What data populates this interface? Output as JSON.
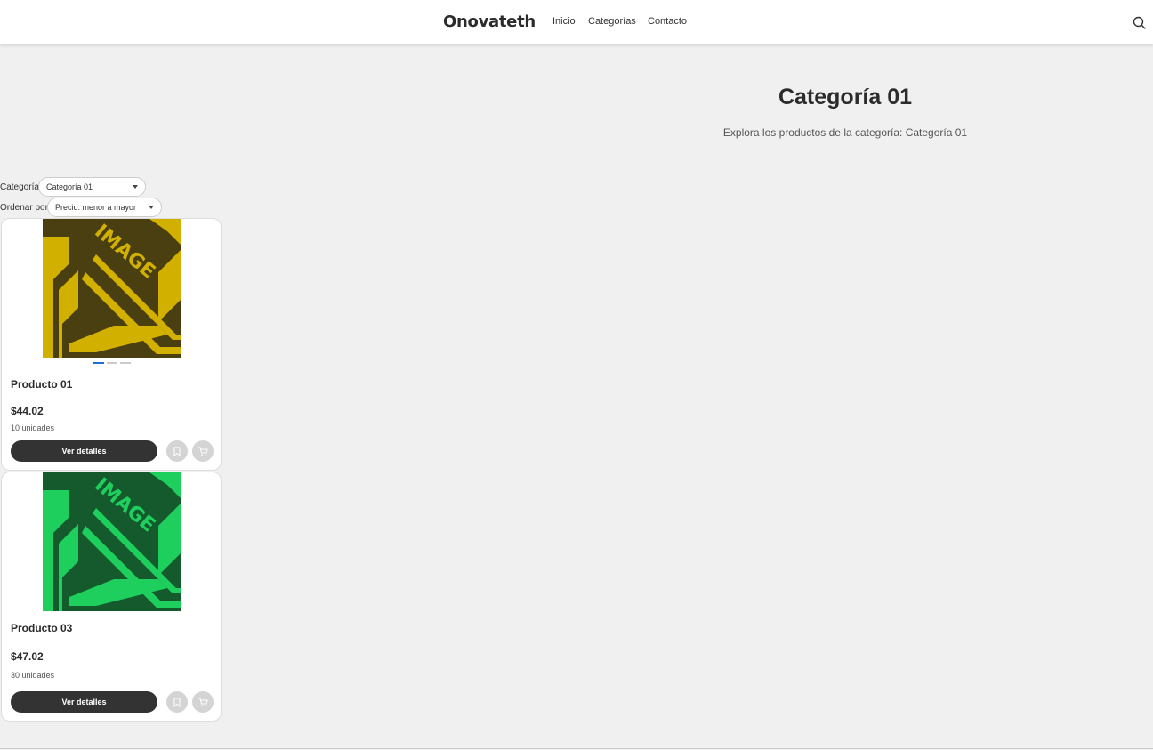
{
  "header": {
    "brand": "Onovateth",
    "nav": [
      "Inicio",
      "Categorías",
      "Contacto"
    ],
    "search_icon": "search-icon"
  },
  "hero": {
    "title": "Categoría 01",
    "subtitle": "Explora los productos de la categoría: Categoría 01"
  },
  "filters": {
    "category_label": "Categoría",
    "category_value": "Categoría 01",
    "order_label": "Ordenar por",
    "order_value": "Precio: menor a mayor"
  },
  "products": [
    {
      "name": "Producto 01",
      "price": "$44.02",
      "units": "10 unidades",
      "details_label": "Ver detalles",
      "image_text": "IMAGE",
      "image_colors": {
        "bg": "#4a3f10",
        "fg": "#d1b000"
      }
    },
    {
      "name": "Producto 03",
      "price": "$47.02",
      "units": "30 unidades",
      "details_label": "Ver detalles",
      "image_text": "IMAGE",
      "image_colors": {
        "bg": "#145a2c",
        "fg": "#1ecf5e"
      }
    }
  ],
  "colors": {
    "accent": "#1e6fd9",
    "dark_button": "#333333",
    "page_bg": "#f0f0f0"
  }
}
